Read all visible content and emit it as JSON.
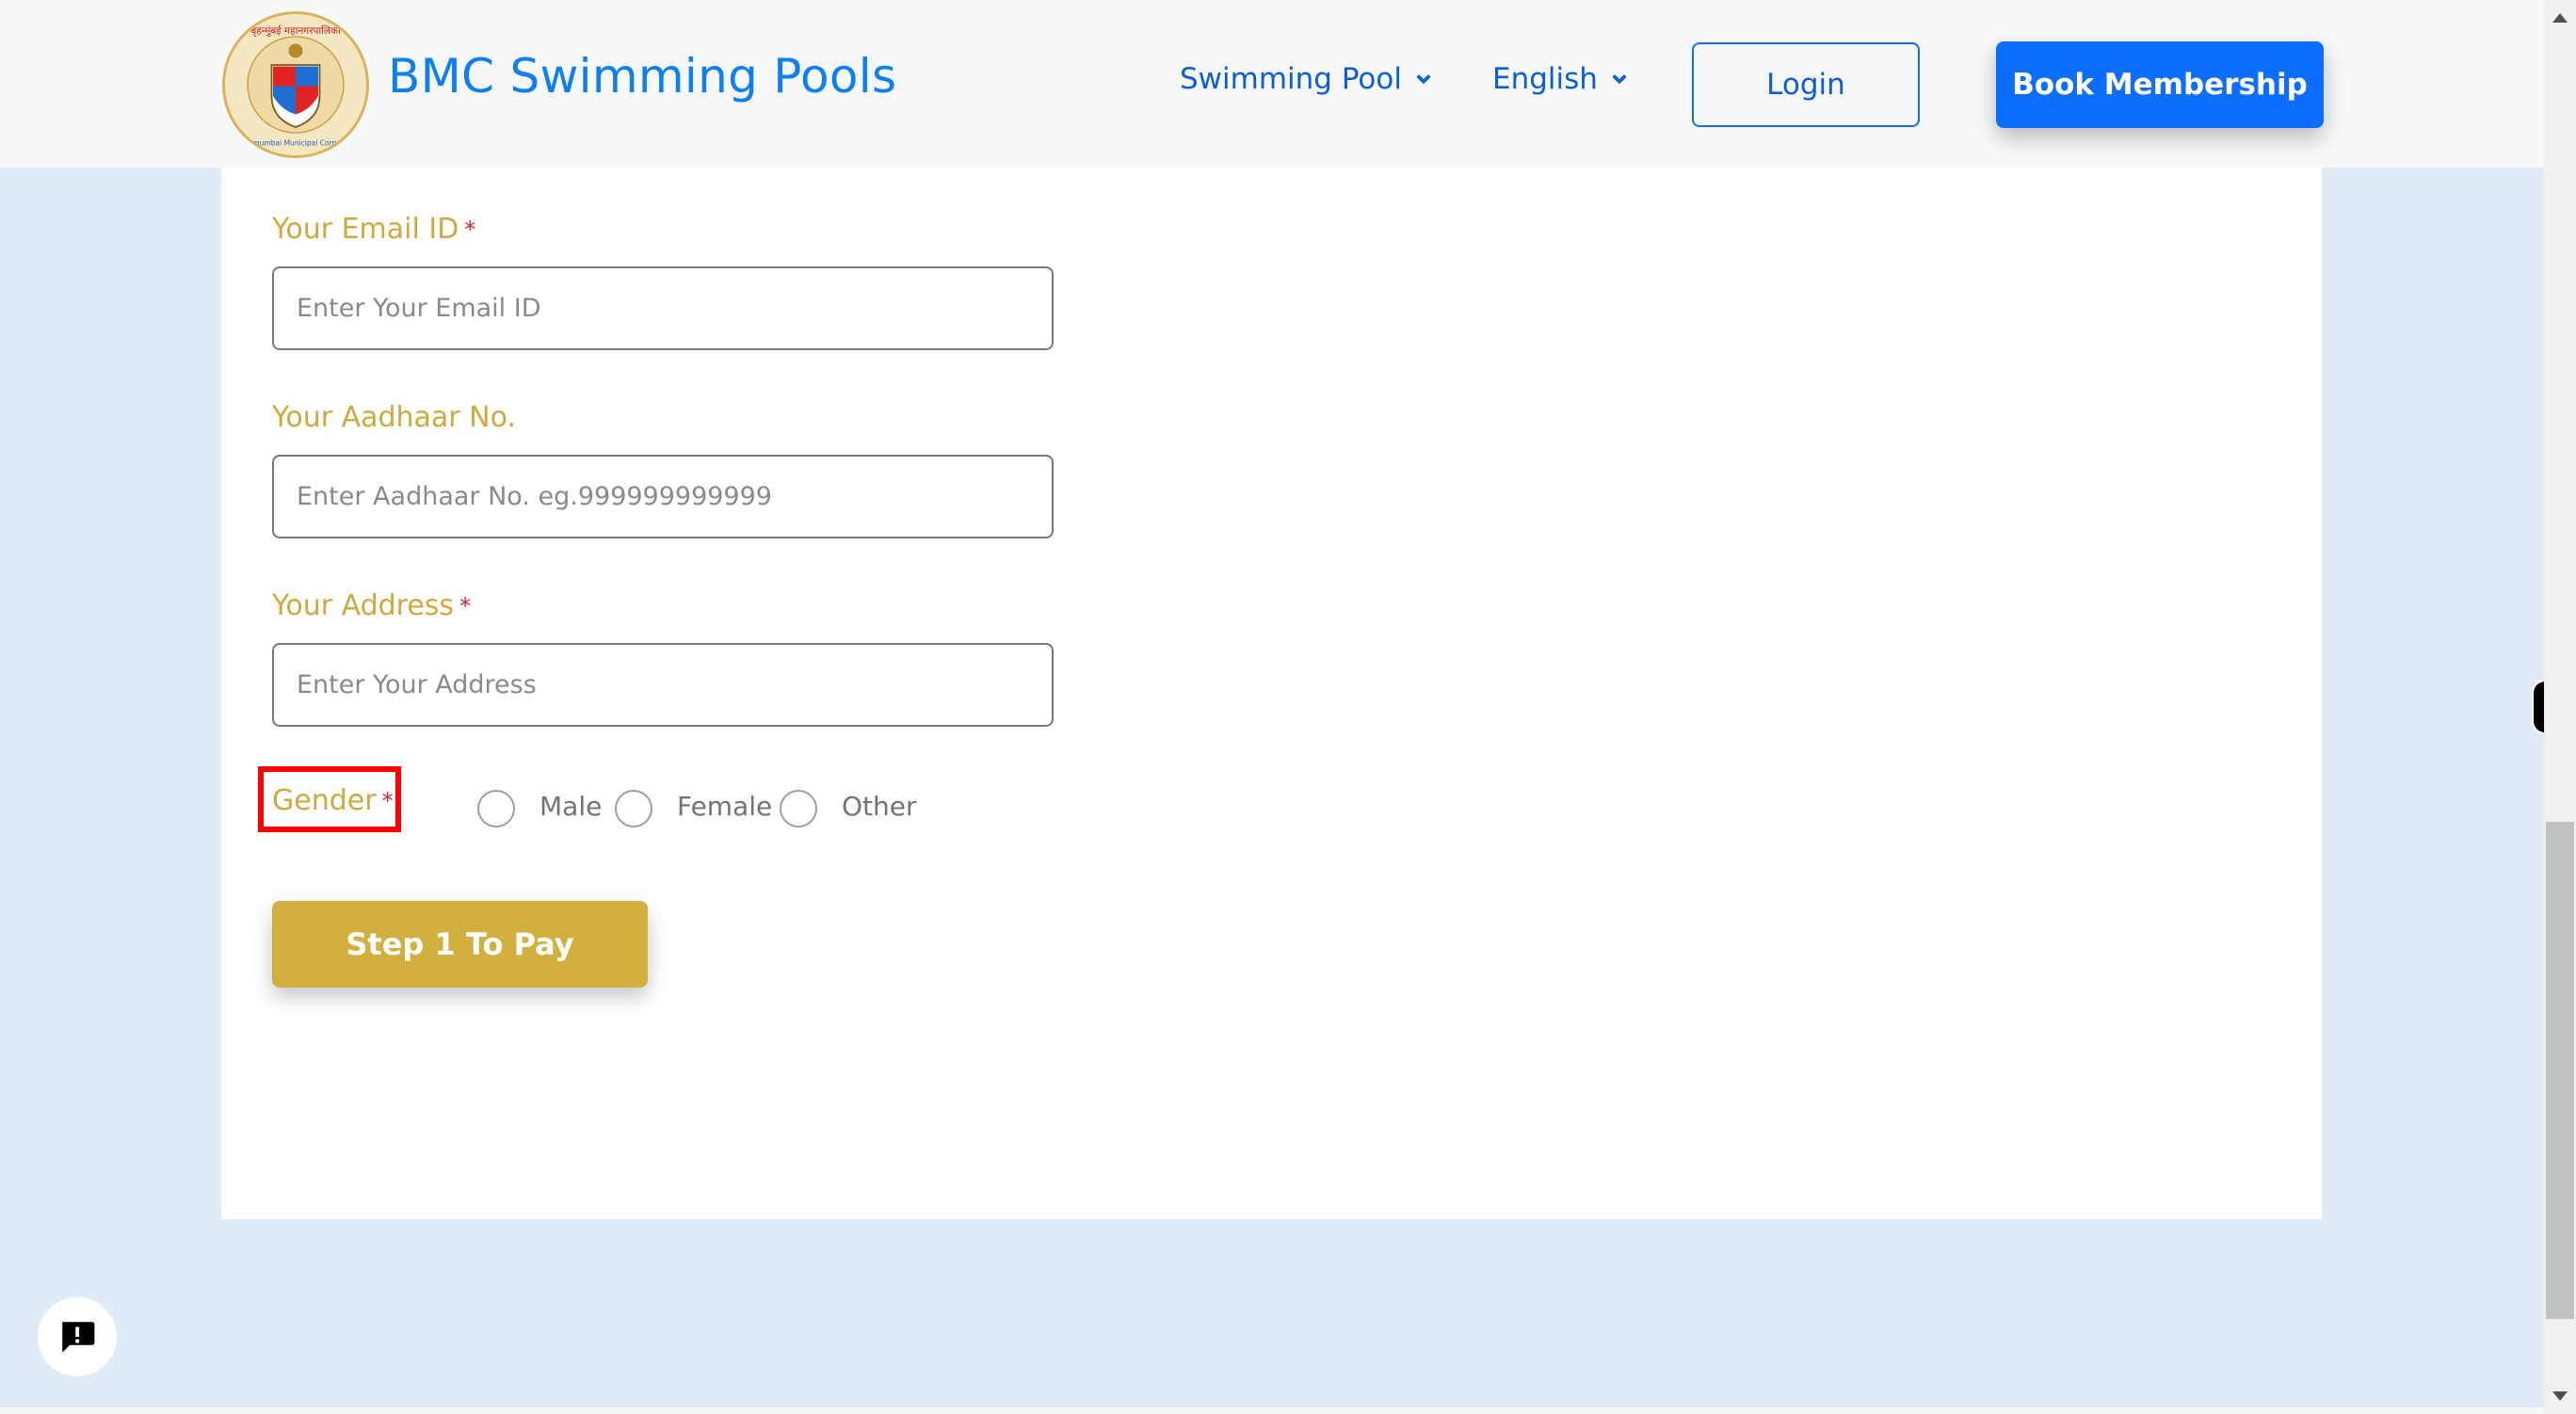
{
  "header": {
    "brand_title": "BMC Swimming Pools",
    "logo_alt": "Brihanmumbai Municipal Corporation emblem",
    "nav": [
      {
        "label": "Swimming Pool",
        "icon": "chevron-down-icon"
      },
      {
        "label": "English",
        "icon": "chevron-down-icon"
      }
    ],
    "login_label": "Login",
    "book_label": "Book Membership"
  },
  "form": {
    "email": {
      "label": "Your Email ID",
      "required_mark": "*",
      "placeholder": "Enter Your Email ID",
      "value": ""
    },
    "aadhaar": {
      "label": "Your Aadhaar No.",
      "placeholder": "Enter Aadhaar No. eg.999999999999",
      "value": ""
    },
    "address": {
      "label": "Your Address",
      "required_mark": "*",
      "placeholder": "Enter Your Address",
      "value": ""
    },
    "gender": {
      "label": "Gender",
      "required_mark": "*",
      "highlighted": true,
      "options": [
        {
          "label": "Male",
          "checked": false
        },
        {
          "label": "Female",
          "checked": false
        },
        {
          "label": "Other",
          "checked": false
        }
      ]
    },
    "submit_label": "Step 1 To Pay"
  },
  "widgets": {
    "feedback_icon": "feedback-alert-icon"
  },
  "colors": {
    "brand_blue": "#0d6efd",
    "label_gold": "#d0a93e",
    "button_gold": "#d2b040",
    "required_red": "#e0202a",
    "highlight_red": "#ff0000",
    "page_bg": "#e0ebf7"
  }
}
